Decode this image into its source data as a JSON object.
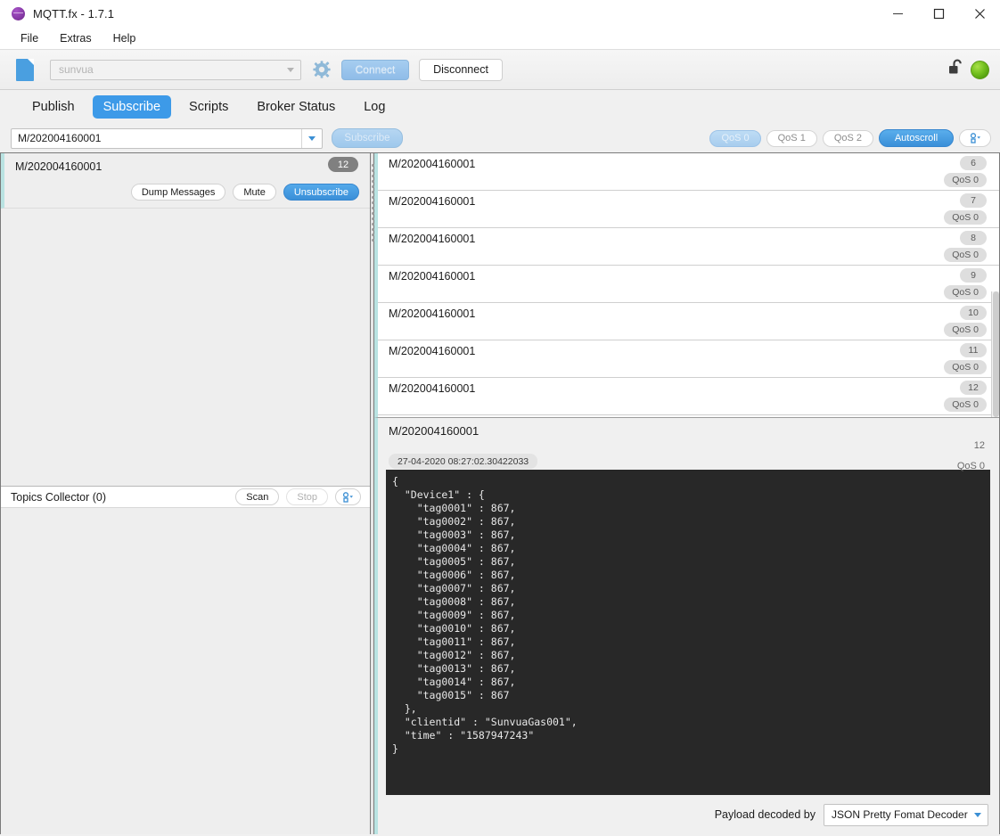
{
  "window": {
    "title": "MQTT.fx - 1.7.1",
    "app_icon": "mqttfx-logo-icon",
    "minimize_label": "minimize-icon",
    "maximize_label": "maximize-icon",
    "close_label": "close-icon"
  },
  "menubar": {
    "items": [
      {
        "label": "File"
      },
      {
        "label": "Extras"
      },
      {
        "label": "Help"
      }
    ]
  },
  "connection_bar": {
    "document_icon": "document-icon",
    "profile_value": "sunvua",
    "profile_placeholder": "sunvua",
    "gear_icon": "gear-icon",
    "connect_label": "Connect",
    "disconnect_label": "Disconnect",
    "lock_icon": "unlocked-padlock-icon",
    "status_indicator": "connected-green-led",
    "status_color": "#72bf1e"
  },
  "tabs": [
    {
      "label": "Publish",
      "active": false
    },
    {
      "label": "Subscribe",
      "active": true
    },
    {
      "label": "Scripts",
      "active": false
    },
    {
      "label": "Broker Status",
      "active": false
    },
    {
      "label": "Log",
      "active": false
    }
  ],
  "subscribe_bar": {
    "topic_value": "M/202004160001",
    "subscribe_label": "Subscribe",
    "qos_options": [
      {
        "label": "QoS 0",
        "selected": true
      },
      {
        "label": "QoS 1",
        "selected": false
      },
      {
        "label": "QoS 2",
        "selected": false
      }
    ],
    "autoscroll_label": "Autoscroll",
    "autoscroll_active": true,
    "config_icon": "settings-dropdown-icon"
  },
  "left_panel": {
    "topics": [
      {
        "name": "M/202004160001",
        "count": "12",
        "dump_label": "Dump Messages",
        "mute_label": "Mute",
        "unsubscribe_label": "Unsubscribe"
      }
    ],
    "collector": {
      "title": "Topics Collector (0)",
      "scan_label": "Scan",
      "stop_label": "Stop",
      "config_icon": "settings-dropdown-icon"
    }
  },
  "message_list": [
    {
      "topic": "M/202004160001",
      "count": "6",
      "qos": "QoS 0"
    },
    {
      "topic": "M/202004160001",
      "count": "7",
      "qos": "QoS 0"
    },
    {
      "topic": "M/202004160001",
      "count": "8",
      "qos": "QoS 0"
    },
    {
      "topic": "M/202004160001",
      "count": "9",
      "qos": "QoS 0"
    },
    {
      "topic": "M/202004160001",
      "count": "10",
      "qos": "QoS 0"
    },
    {
      "topic": "M/202004160001",
      "count": "11",
      "qos": "QoS 0"
    },
    {
      "topic": "M/202004160001",
      "count": "12",
      "qos": "QoS 0"
    }
  ],
  "detail": {
    "topic": "M/202004160001",
    "count": "12",
    "qos": "QoS 0",
    "timestamp": "27-04-2020  08:27:02.30422033",
    "payload": "{\n  \"Device1\" : {\n    \"tag0001\" : 867,\n    \"tag0002\" : 867,\n    \"tag0003\" : 867,\n    \"tag0004\" : 867,\n    \"tag0005\" : 867,\n    \"tag0006\" : 867,\n    \"tag0007\" : 867,\n    \"tag0008\" : 867,\n    \"tag0009\" : 867,\n    \"tag0010\" : 867,\n    \"tag0011\" : 867,\n    \"tag0012\" : 867,\n    \"tag0013\" : 867,\n    \"tag0014\" : 867,\n    \"tag0015\" : 867\n  },\n  \"clientid\" : \"SunvuaGas001\",\n  \"time\" : \"1587947243\"\n}",
    "footer_label": "Payload decoded by",
    "decoder_value": "JSON Pretty Fomat Decoder"
  },
  "colors": {
    "accent_blue": "#3d9ae8",
    "selection_teal": "#b9e3e2",
    "payload_bg": "#282828"
  }
}
